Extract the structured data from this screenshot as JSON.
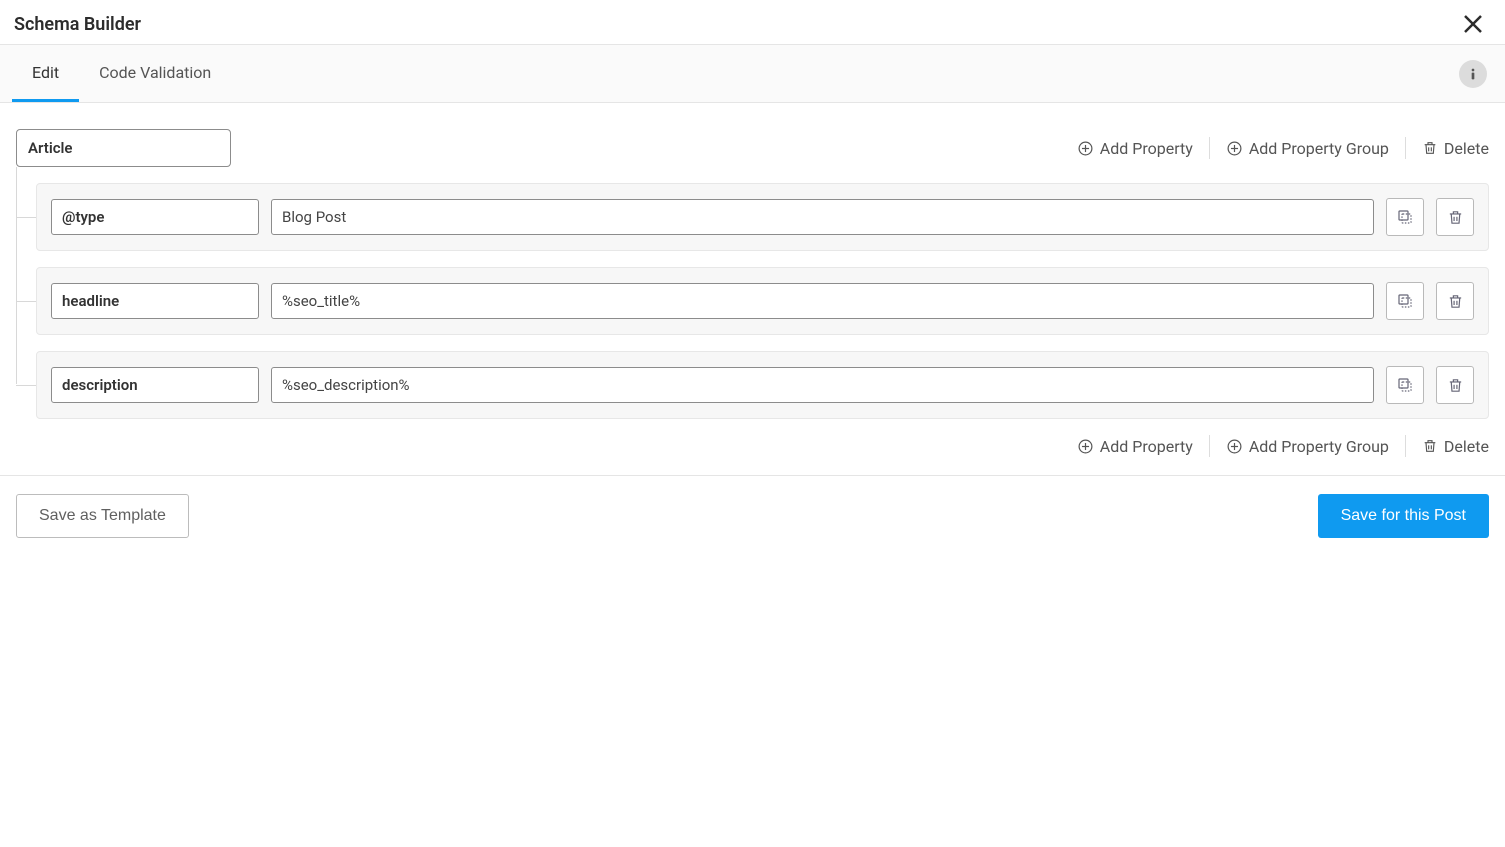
{
  "header": {
    "title": "Schema Builder"
  },
  "tabs": {
    "edit": "Edit",
    "code_validation": "Code Validation"
  },
  "schema": {
    "root": "Article",
    "properties": [
      {
        "key": "@type",
        "value": "Blog Post"
      },
      {
        "key": "headline",
        "value": "%seo_title%"
      },
      {
        "key": "description",
        "value": "%seo_description%"
      }
    ]
  },
  "actions": {
    "add_property": "Add Property",
    "add_property_group": "Add Property Group",
    "delete": "Delete"
  },
  "footer": {
    "save_template": "Save as Template",
    "save_post": "Save for this Post"
  }
}
